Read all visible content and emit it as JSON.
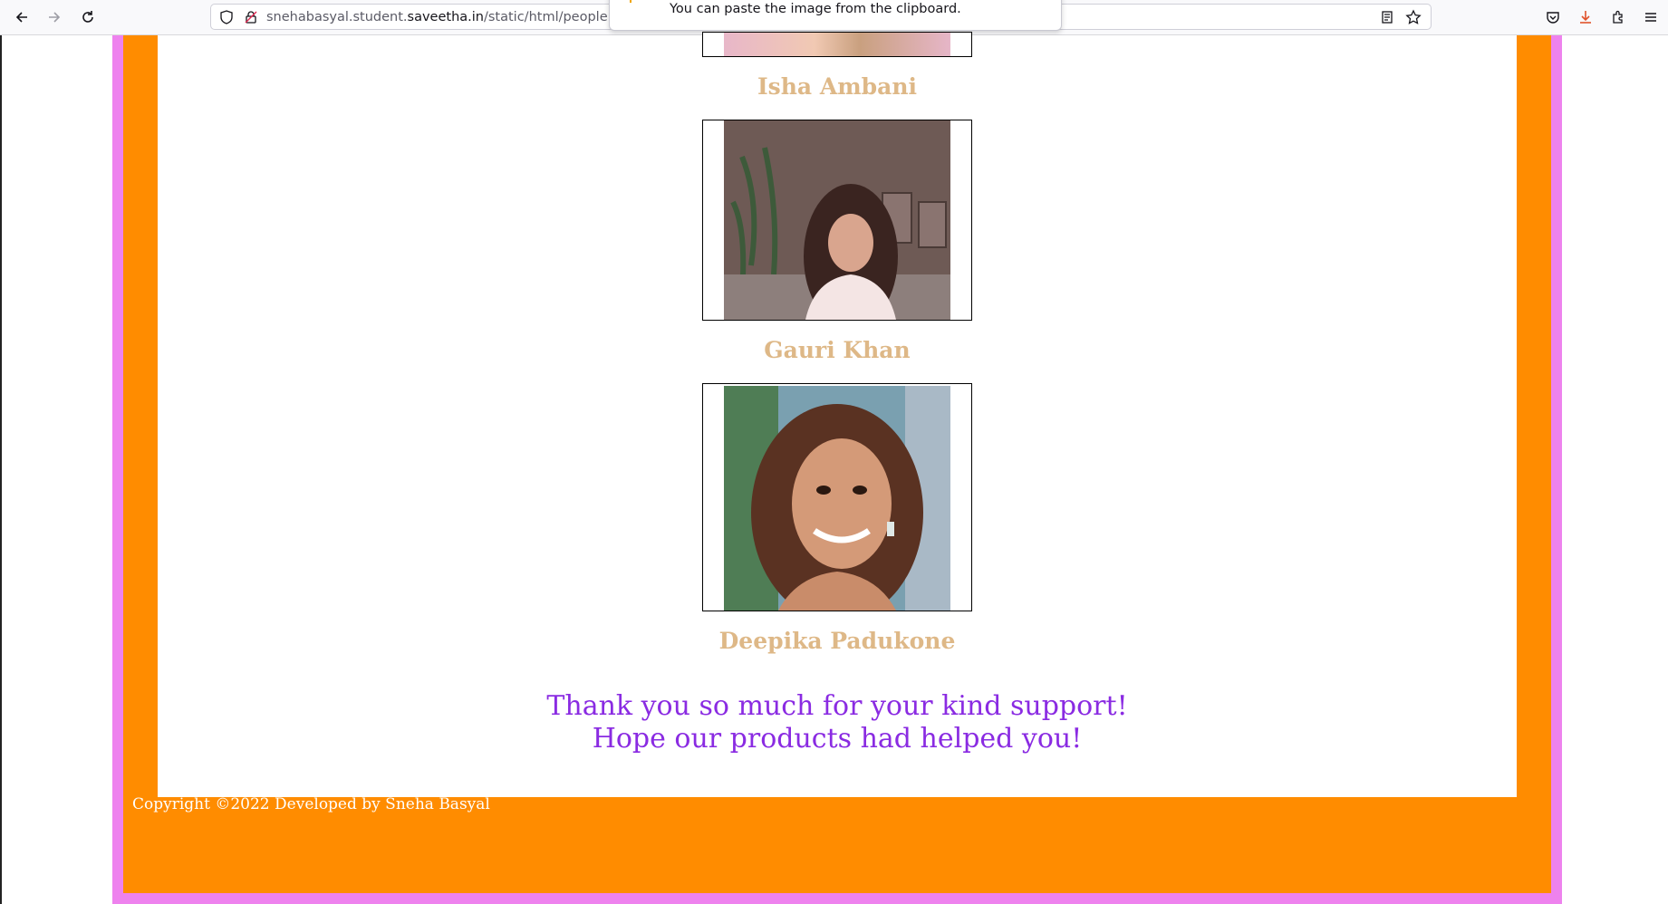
{
  "browser": {
    "url_prefix": "snehabasyal.student.",
    "url_domain": "saveetha.in",
    "url_path": "/static/html/people.ht",
    "popup_message": "You can paste the image from the clipboard.",
    "icons": [
      "back-icon",
      "forward-icon",
      "reload-icon",
      "shield-icon",
      "lock-icon",
      "reader-view-icon",
      "bookmark-star-icon",
      "pocket-icon",
      "download-icon",
      "extensions-icon",
      "menu-icon"
    ]
  },
  "people": [
    {
      "name": "Isha Ambani"
    },
    {
      "name": "Gauri Khan"
    },
    {
      "name": "Deepika Padukone"
    }
  ],
  "thanks": {
    "line1": "Thank you so much for your kind support!",
    "line2": "Hope our products had helped you!"
  },
  "footer": {
    "copyright": "Copyright ©2022 Developed by Sneha Basyal"
  },
  "colors": {
    "pink_border": "#ee82ee",
    "orange_background": "#ff8c00",
    "name_color": "#deb887",
    "thanks_color": "#8a2be2"
  }
}
